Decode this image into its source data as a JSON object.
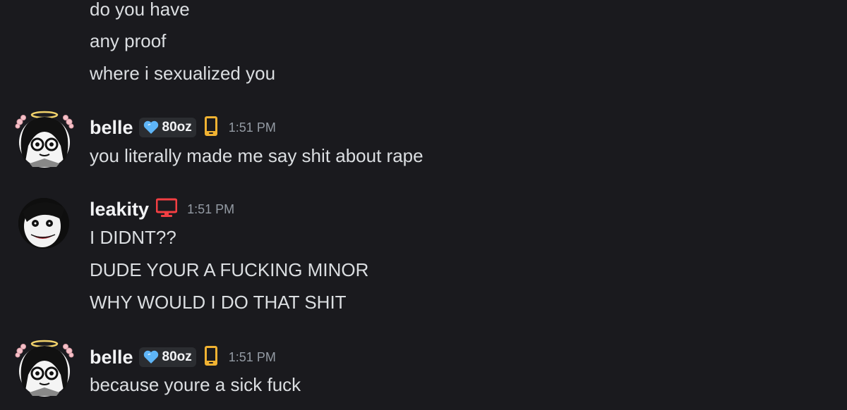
{
  "messages": {
    "continued": {
      "lines": [
        "do you have",
        "any proof",
        "where i sexualized you"
      ]
    },
    "group1": {
      "username": "belle",
      "tag": "80oz",
      "device_icon": "mobile-phone-icon",
      "time": "1:51 PM",
      "lines": [
        "you literally made me say shit about rape"
      ]
    },
    "group2": {
      "username": "leakity",
      "device_icon": "desktop-monitor-icon",
      "time": "1:51 PM",
      "lines": [
        "I DIDNT??",
        "DUDE YOUR A FUCKING MINOR",
        "WHY WOULD I DO THAT SHIT"
      ]
    },
    "group3": {
      "username": "belle",
      "tag": "80oz",
      "device_icon": "mobile-phone-icon",
      "time": "1:51 PM",
      "lines": [
        "because youre a sick fuck"
      ]
    }
  },
  "colors": {
    "background": "#1a1a1e",
    "text": "#dbdee1",
    "timestamp": "#949ba4",
    "mobile_icon": "#f0b232",
    "desktop_icon": "#f23f43",
    "tag_heart": "#5eb5f7"
  }
}
